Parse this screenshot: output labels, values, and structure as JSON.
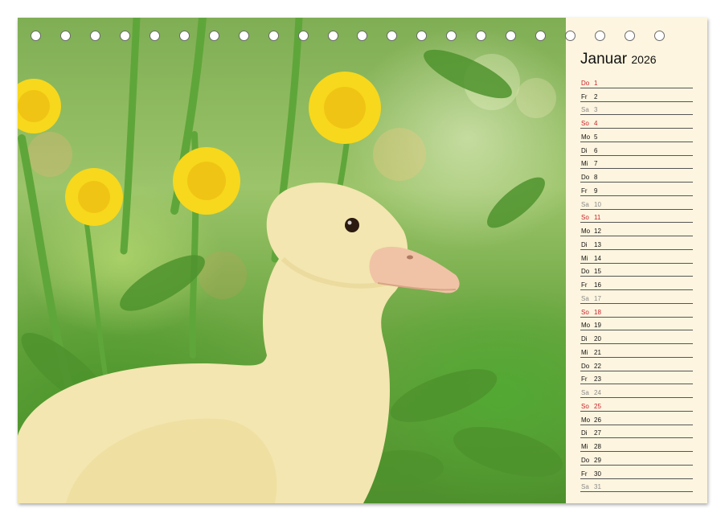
{
  "calendar": {
    "month": "Januar",
    "year": "2026",
    "days": [
      {
        "wd": "Do",
        "num": "1",
        "type": "sun"
      },
      {
        "wd": "Fr",
        "num": "2",
        "type": "weekday"
      },
      {
        "wd": "Sa",
        "num": "3",
        "type": "sat"
      },
      {
        "wd": "So",
        "num": "4",
        "type": "sun"
      },
      {
        "wd": "Mo",
        "num": "5",
        "type": "weekday"
      },
      {
        "wd": "Di",
        "num": "6",
        "type": "weekday"
      },
      {
        "wd": "Mi",
        "num": "7",
        "type": "weekday"
      },
      {
        "wd": "Do",
        "num": "8",
        "type": "weekday"
      },
      {
        "wd": "Fr",
        "num": "9",
        "type": "weekday"
      },
      {
        "wd": "Sa",
        "num": "10",
        "type": "sat"
      },
      {
        "wd": "So",
        "num": "11",
        "type": "sun"
      },
      {
        "wd": "Mo",
        "num": "12",
        "type": "weekday"
      },
      {
        "wd": "Di",
        "num": "13",
        "type": "weekday"
      },
      {
        "wd": "Mi",
        "num": "14",
        "type": "weekday"
      },
      {
        "wd": "Do",
        "num": "15",
        "type": "weekday"
      },
      {
        "wd": "Fr",
        "num": "16",
        "type": "weekday"
      },
      {
        "wd": "Sa",
        "num": "17",
        "type": "sat"
      },
      {
        "wd": "So",
        "num": "18",
        "type": "sun"
      },
      {
        "wd": "Mo",
        "num": "19",
        "type": "weekday"
      },
      {
        "wd": "Di",
        "num": "20",
        "type": "weekday"
      },
      {
        "wd": "Mi",
        "num": "21",
        "type": "weekday"
      },
      {
        "wd": "Do",
        "num": "22",
        "type": "weekday"
      },
      {
        "wd": "Fr",
        "num": "23",
        "type": "weekday"
      },
      {
        "wd": "Sa",
        "num": "24",
        "type": "sat"
      },
      {
        "wd": "So",
        "num": "25",
        "type": "sun"
      },
      {
        "wd": "Mo",
        "num": "26",
        "type": "weekday"
      },
      {
        "wd": "Di",
        "num": "27",
        "type": "weekday"
      },
      {
        "wd": "Mi",
        "num": "28",
        "type": "weekday"
      },
      {
        "wd": "Do",
        "num": "29",
        "type": "weekday"
      },
      {
        "wd": "Fr",
        "num": "30",
        "type": "weekday"
      },
      {
        "wd": "Sa",
        "num": "31",
        "type": "sat"
      }
    ]
  },
  "photo": {
    "subject_icon": "duckling-photo",
    "accent_colors": {
      "duckling": "#f3e6b0",
      "flower": "#f7d81c",
      "grass": "#5c9e34",
      "beak": "#f0c3a6"
    }
  },
  "binding": {
    "ring_count": 22
  }
}
